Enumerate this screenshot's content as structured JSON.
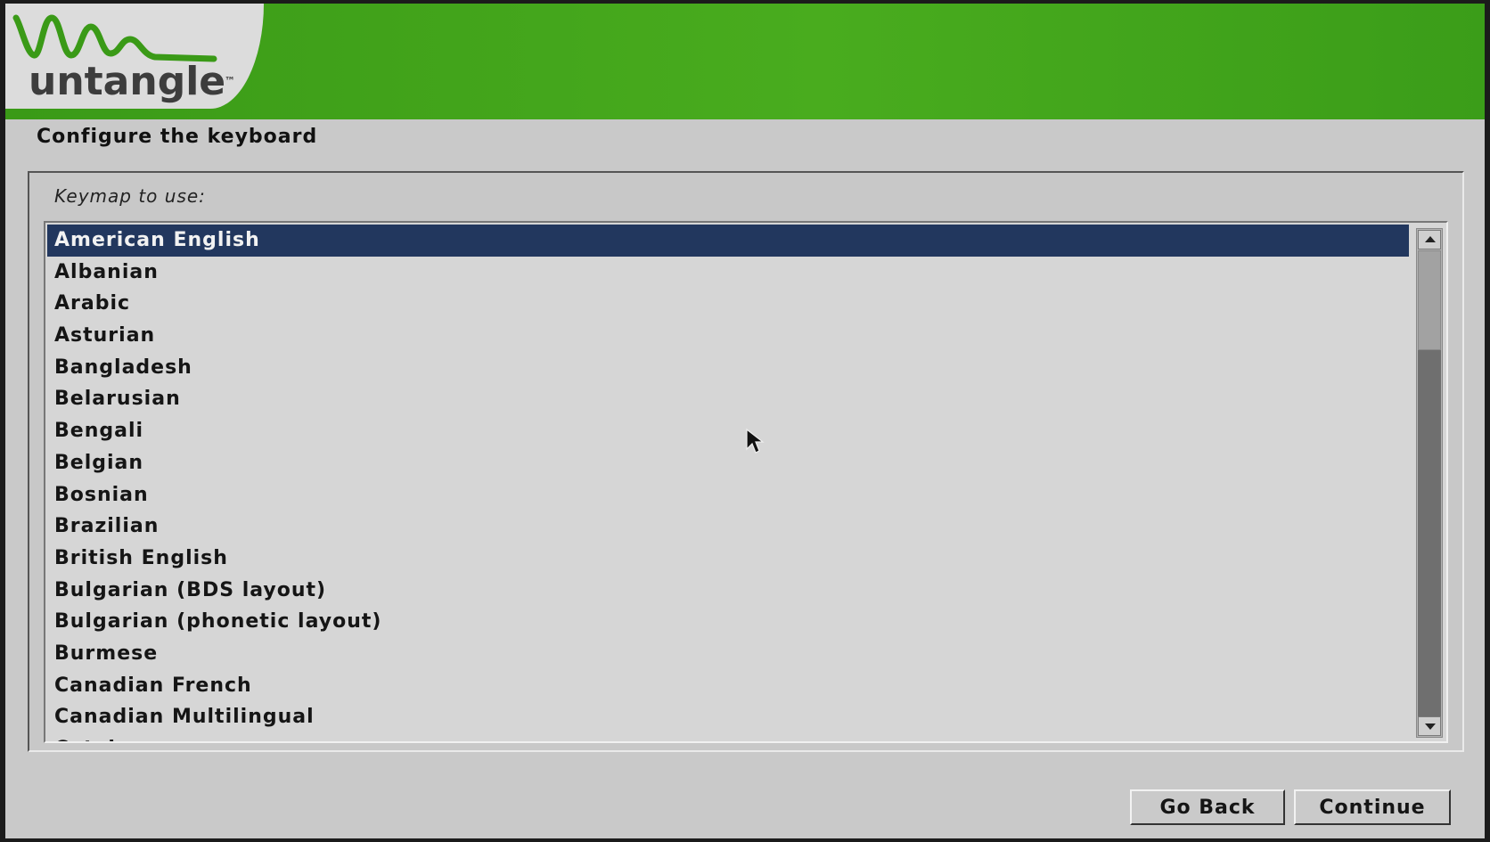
{
  "brand": {
    "logo_text": "untangle",
    "tm": "™",
    "header_color": "#45a81c"
  },
  "page": {
    "title": "Configure the keyboard"
  },
  "question": {
    "label": "Keymap to use:"
  },
  "keymaps": {
    "selected_index": 0,
    "selection_color": "#22375e",
    "items": [
      "American English",
      "Albanian",
      "Arabic",
      "Asturian",
      "Bangladesh",
      "Belarusian",
      "Bengali",
      "Belgian",
      "Bosnian",
      "Brazilian",
      "British English",
      "Bulgarian (BDS layout)",
      "Bulgarian (phonetic layout)",
      "Burmese",
      "Canadian French",
      "Canadian Multilingual",
      "Catalan"
    ]
  },
  "buttons": {
    "back_label": "Go Back",
    "continue_label": "Continue"
  },
  "icons": {
    "scroll_up": "arrow-up-icon",
    "scroll_down": "arrow-down-icon",
    "pointer": "mouse-pointer-icon"
  }
}
